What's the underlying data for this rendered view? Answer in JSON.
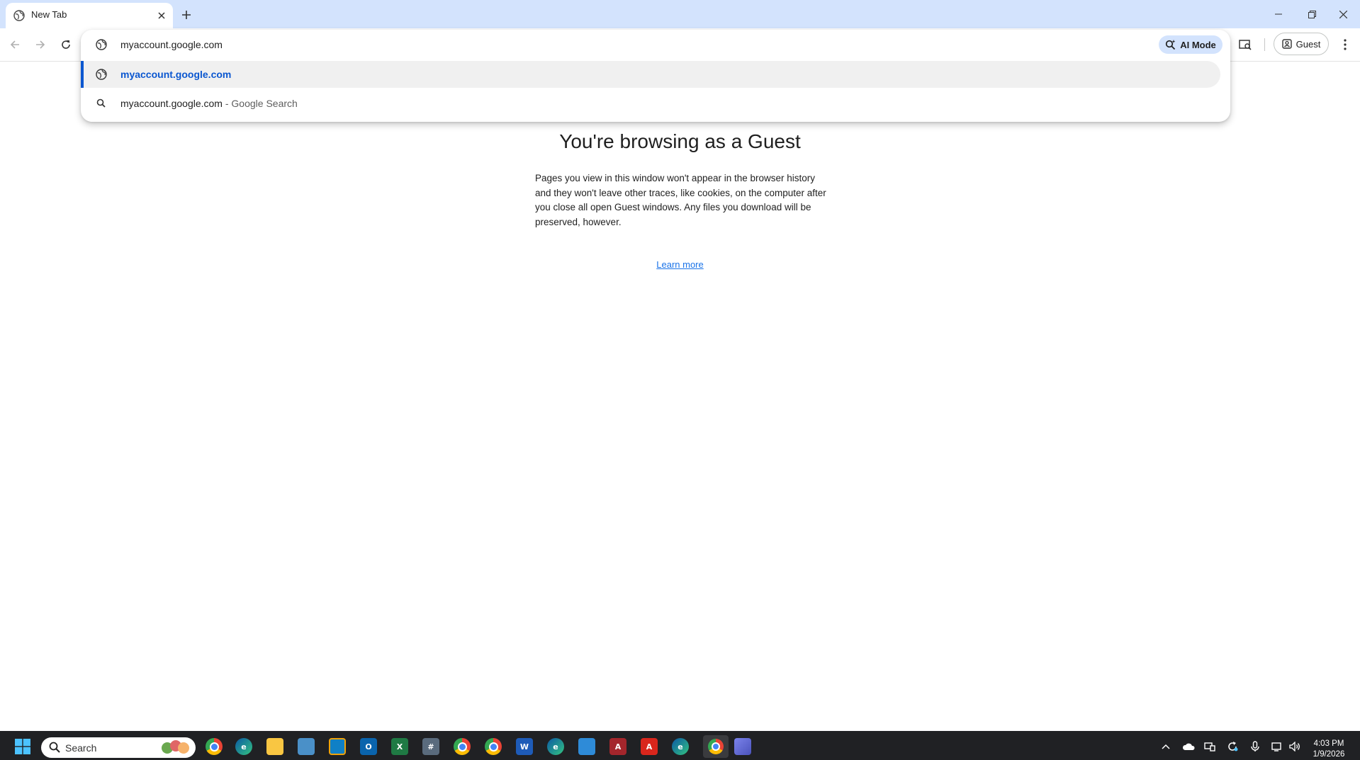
{
  "tab": {
    "title": "New Tab",
    "icon": "globe-icon"
  },
  "window_controls": [
    "minimize-icon",
    "restore-icon",
    "close-icon"
  ],
  "omnibox": {
    "value": "myaccount.google.com",
    "ai_mode_label": "AI Mode",
    "suggestions": [
      {
        "text": "myaccount.google.com",
        "suffix": "",
        "icon": "globe-icon",
        "selected": true
      },
      {
        "text": "myaccount.google.com",
        "suffix": " - Google Search",
        "icon": "search-icon",
        "selected": false
      }
    ]
  },
  "toolbar": {
    "profile_label": "Guest"
  },
  "page": {
    "title": "You're browsing as a Guest",
    "body": "Pages you view in this window won't appear in the browser history and they won't leave other traces, like cookies, on the computer after you close all open Guest windows. Any files you download will be preserved, however.",
    "learn_more": "Learn more"
  },
  "taskbar": {
    "search_placeholder": "Search",
    "time": "4:03 PM",
    "date": "1/9/2026",
    "apps": [
      "chrome",
      "edge",
      "file-explorer",
      "remote-desktop",
      "snipping",
      "outlook",
      "excel",
      "calculator",
      "chrome-profile-m",
      "chrome-profile-m2",
      "word",
      "edge-beta",
      "notepad",
      "access",
      "acrobat",
      "edge-dev",
      "chrome-active",
      "teams"
    ]
  },
  "colors": {
    "tabstrip": "#d3e3fd",
    "accent": "#0b57d0",
    "link": "#1a73e8",
    "taskbar": "#202124"
  }
}
